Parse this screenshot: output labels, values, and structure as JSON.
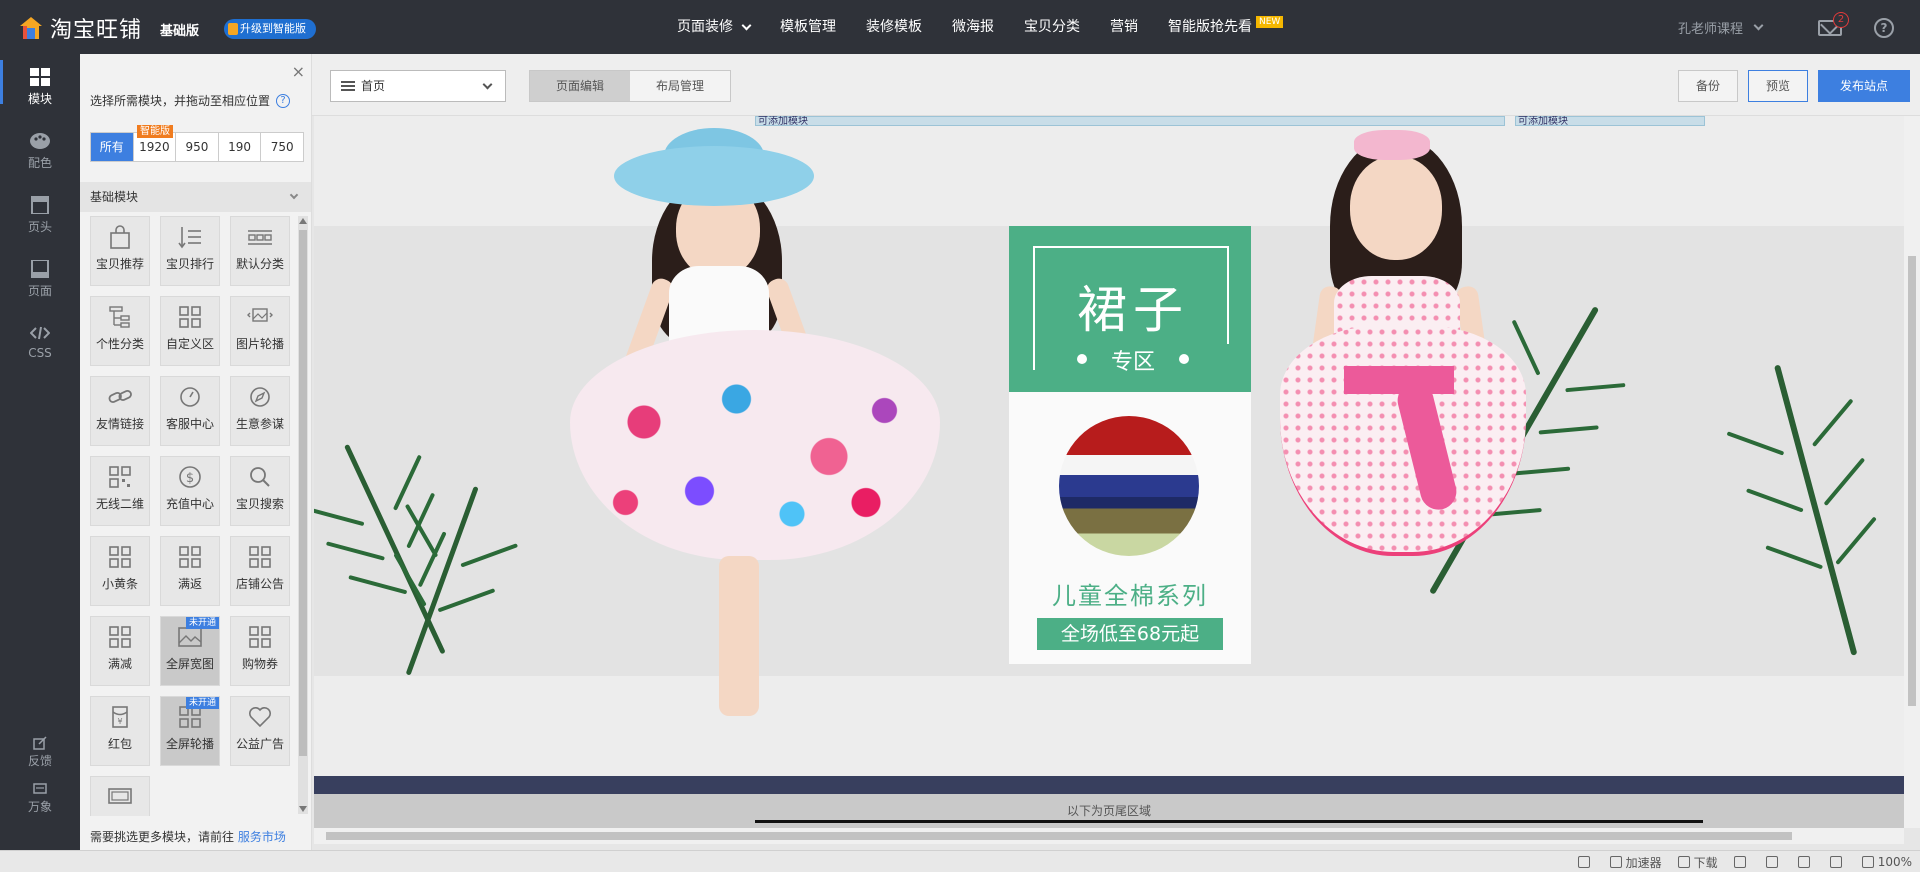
{
  "topbar": {
    "brand": "淘宝旺铺",
    "edition": "基础版",
    "upgrade": "升级到智能版",
    "nav": [
      {
        "label": "页面装修",
        "dropdown": true
      },
      {
        "label": "模板管理"
      },
      {
        "label": "装修模板"
      },
      {
        "label": "微海报"
      },
      {
        "label": "宝贝分类"
      },
      {
        "label": "营销"
      },
      {
        "label": "智能版抢先看",
        "badge": "NEW"
      }
    ],
    "user": "孔老师课程",
    "mail_count": "2",
    "help": "?"
  },
  "rail": {
    "items": [
      {
        "label": "模块",
        "icon": "grid-icon",
        "active": true
      },
      {
        "label": "配色",
        "icon": "palette-icon"
      },
      {
        "label": "页头",
        "icon": "header-icon"
      },
      {
        "label": "页面",
        "icon": "page-icon"
      },
      {
        "label": "CSS",
        "icon": "code-icon"
      }
    ],
    "bottom": [
      {
        "label": "反馈",
        "icon": "feedback-icon"
      },
      {
        "label": "万象",
        "icon": "chat-icon"
      }
    ]
  },
  "panel": {
    "close": "×",
    "hint": "选择所需模块，并拖动至相应位置",
    "filters": [
      "所有",
      "1920",
      "950",
      "190",
      "750"
    ],
    "smart_badge": "智能版",
    "category": "基础模块",
    "modules": [
      {
        "label": "宝贝推荐",
        "icon": "bag-icon"
      },
      {
        "label": "宝贝排行",
        "icon": "ranking-icon"
      },
      {
        "label": "默认分类",
        "icon": "category-icon"
      },
      {
        "label": "个性分类",
        "icon": "tree-icon"
      },
      {
        "label": "自定义区",
        "icon": "custom-grid-icon"
      },
      {
        "label": "图片轮播",
        "icon": "carousel-icon"
      },
      {
        "label": "友情链接",
        "icon": "link-icon"
      },
      {
        "label": "客服中心",
        "icon": "headset-icon"
      },
      {
        "label": "生意参谋",
        "icon": "compass-icon"
      },
      {
        "label": "无线二维",
        "icon": "qrcode-icon"
      },
      {
        "label": "充值中心",
        "icon": "dollar-icon"
      },
      {
        "label": "宝贝搜索",
        "icon": "search-icon"
      },
      {
        "label": "小黄条",
        "icon": "grid-icon"
      },
      {
        "label": "满返",
        "icon": "grid-icon"
      },
      {
        "label": "店铺公告",
        "icon": "grid-icon"
      },
      {
        "label": "满减",
        "icon": "grid-icon"
      },
      {
        "label": "全屏宽图",
        "icon": "image-icon",
        "badge": "未开通",
        "dim": true
      },
      {
        "label": "购物券",
        "icon": "grid-icon"
      },
      {
        "label": "红包",
        "icon": "redpacket-icon"
      },
      {
        "label": "全屏轮播",
        "icon": "grid-icon",
        "badge": "未开通",
        "dim": true
      },
      {
        "label": "公益广告",
        "icon": "heart-icon"
      },
      {
        "label": "",
        "icon": "screen-icon"
      }
    ],
    "footer_text": "需要挑选更多模块，请前往",
    "footer_link": "服务市场"
  },
  "toolbar": {
    "page_select": "首页",
    "tabs": [
      {
        "label": "页面编辑",
        "active": true
      },
      {
        "label": "布局管理"
      }
    ],
    "backup": "备份",
    "preview": "预览",
    "publish": "发布站点"
  },
  "canvas": {
    "slot_label_a": "可添加模块",
    "slot_label_b": "可添加模块",
    "promo_title": "裙子",
    "promo_sub": "专区",
    "promo_line1": "儿童全棉系列",
    "promo_line2": "全场低至68元起",
    "footer_zone": "以下为页尾区域"
  },
  "status": {
    "items": [
      {
        "label": "",
        "icon": "cycle-icon"
      },
      {
        "label": "加速器",
        "icon": "rocket-icon"
      },
      {
        "label": "下载",
        "icon": "download-icon"
      },
      {
        "label": "",
        "icon": "flag-icon"
      },
      {
        "label": "",
        "icon": "edge-icon"
      },
      {
        "label": "",
        "icon": "window-icon"
      },
      {
        "label": "",
        "icon": "volume-icon"
      },
      {
        "label": "100%",
        "icon": "zoom-icon"
      }
    ]
  },
  "colors": {
    "topbar": "#2f3239",
    "accent": "#3d7fe0",
    "promo_green": "#4caf86",
    "footer_navy": "#383f5e"
  }
}
